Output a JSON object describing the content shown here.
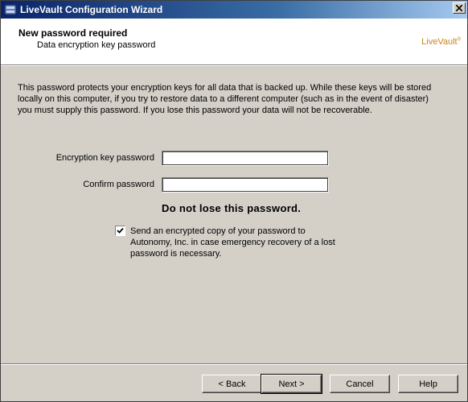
{
  "window": {
    "title": "LiveVault Configuration Wizard"
  },
  "header": {
    "title": "New password required",
    "subtitle": "Data encryption key password",
    "brand": "LiveVault"
  },
  "intro_text": "This password protects your encryption keys for all data that is backed up. While these keys will be stored locally on this computer, if you try to restore data to a different computer (such as in the event of disaster) you must supply this password. If you lose this password your data will not be recoverable.",
  "form": {
    "encryption_key_label": "Encryption key password",
    "encryption_key_value": "",
    "confirm_label": "Confirm password",
    "confirm_value": ""
  },
  "warning": "Do not lose this password.",
  "escrow_checkbox": {
    "checked": true,
    "label": "Send an encrypted copy of your password to Autonomy, Inc. in case emergency recovery of a lost password is necessary."
  },
  "buttons": {
    "back": "< Back",
    "next": "Next >",
    "cancel": "Cancel",
    "help": "Help"
  },
  "colors": {
    "titlebar": "#0a246a",
    "brand": "#c8841a",
    "face": "#d4d0c8"
  }
}
